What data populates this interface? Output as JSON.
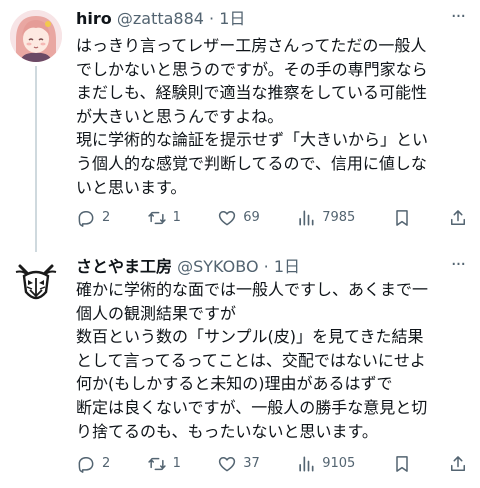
{
  "tweets": [
    {
      "name": "hiro",
      "handle": "@zatta884",
      "time": "1日",
      "lines": [
        "はっきり言ってレザー工房さんってただの一般人",
        "でしかないと思うのですが。その手の専門家なら",
        "まだしも、経験則で適当な推察をしている可能性",
        "が大きいと思うんですよね。",
        "現に学術的な論証を提示せず「大きいから」とい",
        "う個人的な感覚で判断してるので、信用に値しな",
        "いと思います。"
      ],
      "replies": "2",
      "reposts": "1",
      "likes": "69",
      "views": "7985"
    },
    {
      "name": "さとやま工房",
      "handle": "@SYKOBO",
      "time": "1日",
      "lines": [
        "確かに学術的な面では一般人ですし、あくまで一",
        "個人の観測結果ですが",
        "数百という数の「サンプル(皮)」を見てきた結果",
        "として言ってるってことは、交配ではないにせよ",
        "何か(もしかすると未知の)理由があるはずで",
        "断定は良くないですが、一般人の勝手な意見と切",
        "り捨てるのも、もったいないと思います。"
      ],
      "replies": "2",
      "reposts": "1",
      "likes": "37",
      "views": "9105"
    }
  ],
  "separator": "·",
  "more_label": "···",
  "colors": {
    "text": "#0f1419",
    "secondary": "#536471",
    "thread_line": "#cfd9de",
    "avatar_bg": "#f6dfe0"
  },
  "icons": [
    "reply-icon",
    "repost-icon",
    "like-icon",
    "views-icon",
    "bookmark-icon",
    "share-icon",
    "more-icon"
  ]
}
